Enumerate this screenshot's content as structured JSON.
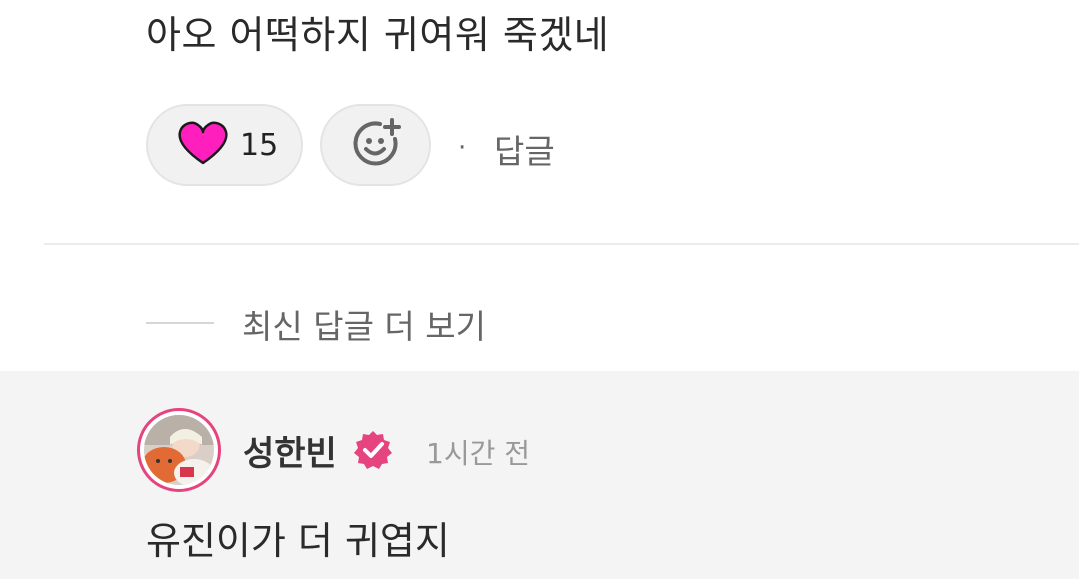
{
  "comment": {
    "text": "아오 어떡하지 귀여워 죽겠네",
    "like_count": "15",
    "reply_label": "답글",
    "separator": "·"
  },
  "more_replies_label": "최신 답글 더 보기",
  "reply": {
    "author": "성한빈",
    "time": "1시간 전",
    "text": "유진이가 더 귀엽지"
  },
  "colors": {
    "heart": "#ff1fbd",
    "verified": "#e5447e",
    "reply_background": "#f4f4f4"
  },
  "icons": {
    "like": "heart-icon",
    "add_reaction": "add-emoji-icon",
    "verified": "verified-badge-icon"
  }
}
